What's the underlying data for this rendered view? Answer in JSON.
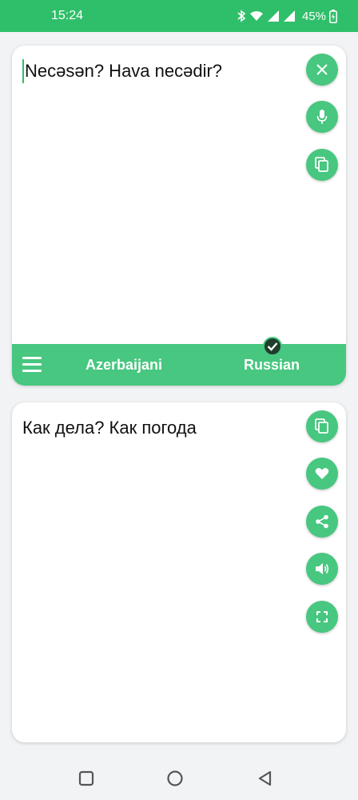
{
  "status_bar": {
    "time": "15:24",
    "battery": "45%",
    "icons": [
      "bluetooth-icon",
      "wifi-icon",
      "signal-icon",
      "signal-icon",
      "battery-icon"
    ]
  },
  "source_panel": {
    "text": "Necəsən? Hava necədir?",
    "buttons": [
      "close-icon",
      "microphone-icon",
      "copy-icon"
    ]
  },
  "language_bar": {
    "source_language": "Azerbaijani",
    "target_language": "Russian",
    "menu_icon": "hamburger-icon",
    "selected_indicator": "check-icon"
  },
  "target_panel": {
    "text": "Как дела? Как погода",
    "buttons": [
      "copy-icon",
      "heart-icon",
      "share-icon",
      "speaker-icon",
      "fullscreen-icon"
    ]
  },
  "nav_bar": {
    "buttons": [
      "recents-square-icon",
      "home-circle-icon",
      "back-triangle-icon"
    ]
  },
  "colors": {
    "accent": "#47c77f",
    "status_bar": "#2fbf6a",
    "background": "#f2f3f5"
  }
}
